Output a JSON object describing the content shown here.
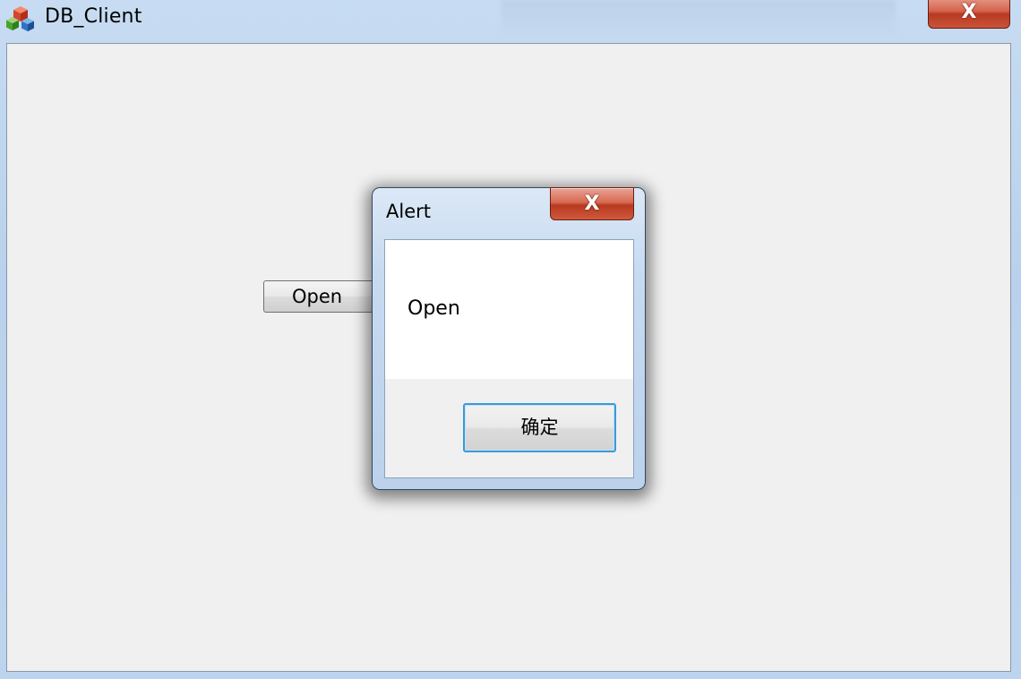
{
  "window": {
    "title": "DB_Client",
    "icon": "app-cubes-icon",
    "close_glyph": "X"
  },
  "main": {
    "open_button_label": "Open"
  },
  "alert": {
    "title": "Alert",
    "close_glyph": "X",
    "message": "Open",
    "ok_button_label": "确定"
  },
  "colors": {
    "close_button": "#c9533a",
    "ok_button_focus": "#3c9ad6",
    "client_bg": "#f0f0f0"
  }
}
